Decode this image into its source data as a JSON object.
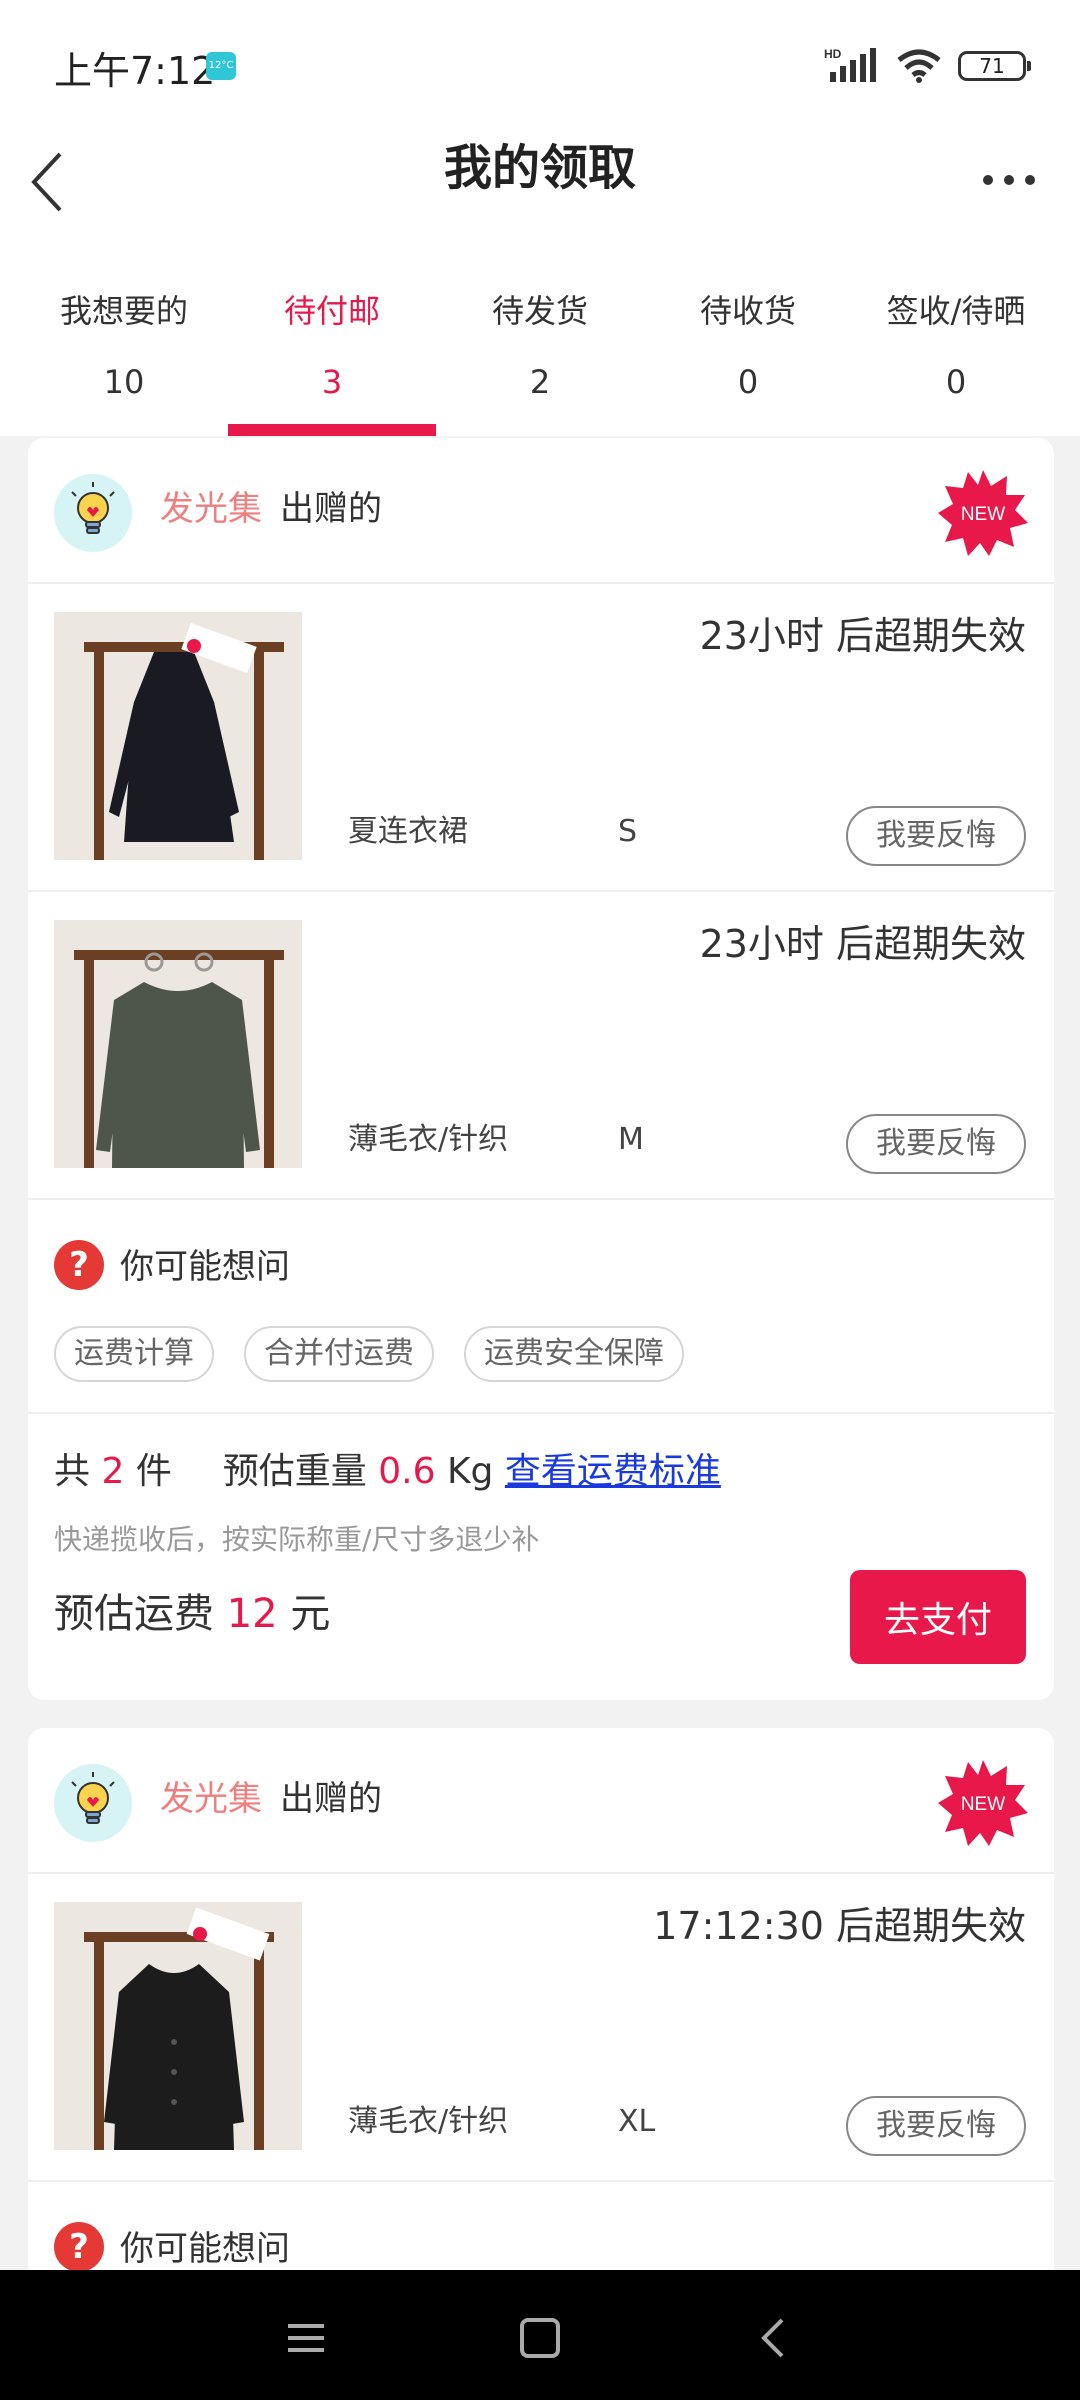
{
  "status": {
    "time": "上午7:12",
    "temp": "12°C",
    "network": "HD",
    "battery": "71"
  },
  "nav": {
    "title": "我的领取"
  },
  "tabs": [
    {
      "label": "我想要的",
      "count": "10"
    },
    {
      "label": "待付邮",
      "count": "3"
    },
    {
      "label": "待发货",
      "count": "2"
    },
    {
      "label": "待收货",
      "count": "0"
    },
    {
      "label": "签收/待晒",
      "count": "0"
    }
  ],
  "active_tab": 1,
  "orders": [
    {
      "donor": "发光集",
      "donor_suffix": "出赠的",
      "badge": "NEW",
      "items": [
        {
          "expiry": "23小时 后超期失效",
          "name": "夏连衣裙",
          "size": "S",
          "action": "我要反悔"
        },
        {
          "expiry": "23小时 后超期失效",
          "name": "薄毛衣/针织",
          "size": "M",
          "action": "我要反悔"
        }
      ],
      "faq": {
        "title": "你可能想问",
        "tags": [
          "运费计算",
          "合并付运费",
          "运费安全保障"
        ]
      },
      "summary": {
        "total_prefix": "共",
        "count": "2",
        "count_unit": "件",
        "weight_label": "预估重量",
        "weight": "0.6",
        "weight_unit": "Kg",
        "fee_link": "查看运费标准",
        "note": "快递揽收后，按实际称重/尺寸多退少补",
        "fee_label": "预估运费",
        "fee": "12",
        "fee_unit": "元",
        "pay_button": "去支付"
      }
    },
    {
      "donor": "发光集",
      "donor_suffix": "出赠的",
      "badge": "NEW",
      "items": [
        {
          "expiry": "17:12:30 后超期失效",
          "name": "薄毛衣/针织",
          "size": "XL",
          "action": "我要反悔"
        }
      ],
      "faq": {
        "title": "你可能想问"
      }
    }
  ],
  "colors": {
    "accent": "#e8194a",
    "donor": "#f08080",
    "link": "#1a3ae0",
    "page_bg": "#f2f2f2"
  },
  "icons": [
    "back-icon",
    "more-icon",
    "lightbulb-icon",
    "new-starburst-icon",
    "question-icon",
    "menu-icon",
    "home-icon",
    "back-nav-icon"
  ]
}
